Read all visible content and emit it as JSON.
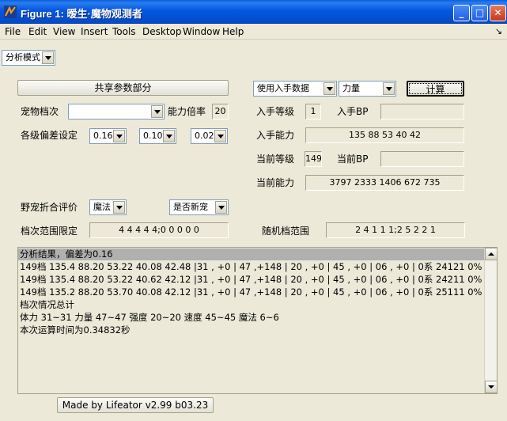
{
  "window": {
    "title": "Figure 1: 暧生·魔物观测者",
    "minimize": "_",
    "maximize": "□",
    "close": "✕"
  },
  "menu": [
    "File",
    "Edit",
    "View",
    "Insert",
    "Tools",
    "Desktop",
    "Window",
    "Help"
  ],
  "menu_arrow": "↘",
  "mode_select": "分析模式",
  "shared_params_button": "共享参数部分",
  "input_source_select": "使用入手数据",
  "attribute_select": "力量",
  "calc_button": "计算",
  "pet_grade": {
    "label": "宠物档次",
    "value": ""
  },
  "ability_ratio": {
    "label": "能力倍率",
    "value": "20"
  },
  "deviation": {
    "label": "各级偏差设定",
    "values": [
      "0.16",
      "0.10",
      "0.02"
    ]
  },
  "acquire_level": {
    "label": "入手等级",
    "value": "1"
  },
  "acquire_bp": {
    "label": "入手BP",
    "value": ""
  },
  "acquire_ability": {
    "label": "入手能力",
    "value": "135 88 53 40 42"
  },
  "current_level": {
    "label": "当前等级",
    "value": "149"
  },
  "current_bp": {
    "label": "当前BP",
    "value": ""
  },
  "current_ability": {
    "label": "当前能力",
    "value": "3797 2333 1406 672 735"
  },
  "wild_eval": {
    "label": "野宠折合评价",
    "select": "魔法",
    "new_pet_select": "是否新宠"
  },
  "grade_range": {
    "label": "档次范围限定",
    "value": "4 4 4 4 4;0 0 0 0 0"
  },
  "random_range": {
    "label": "随机档范围",
    "value": "2 4 1 1 1;2 5 2 2 1"
  },
  "output_lines": [
    "分析结果，偏差为0.16",
    "149档 135.4 88.20 53.22 40.08 42.48 |31 , +0 | 47 ,+148 | 20 , +0 | 45 , +0 | 06 , +0 | 0系 24121   0% *",
    "149档 135.4 88.20 53.22 40.62 42.12 |31 , +0 | 47 ,+148 | 20 , +0 | 45 , +0 | 06 , +0 | 0系 24211   0% *",
    "149档 135.2 88.20 53.70 40.08 42.12 |31 , +0 | 47 ,+148 | 20 , +0 | 45 , +0 | 06 , +0 | 0系 25111   0% *",
    "档次情况总计",
    "体力 31~31 力量 47~47 强度 20~20 速度 45~45 魔法 6~6",
    "本次运算时间为0.34832秒"
  ],
  "footer_button": "Made by Lifeator   v2.99 b03.23",
  "colors": {
    "titlebar": "#0558e0",
    "background": "#ece9d8",
    "highlight": "#b0b0b0"
  }
}
